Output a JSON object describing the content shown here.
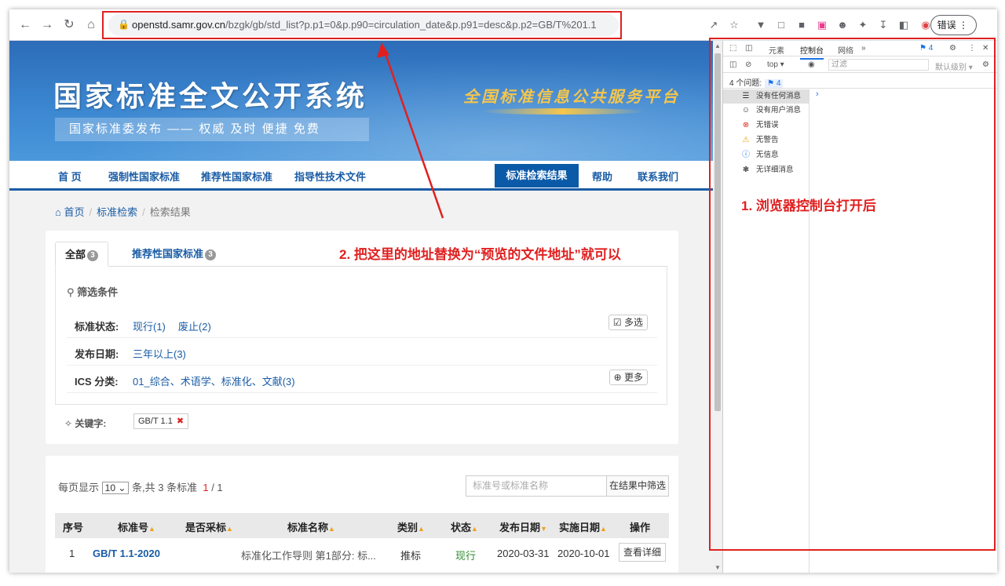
{
  "browser": {
    "url_host": "openstd.samr.gov.cn",
    "url_path": "/bzgk/gb/std_list?p.p1=0&p.p90=circulation_date&p.p91=desc&p.p2=GB/T%201.1",
    "profile_label": "错误"
  },
  "site": {
    "title": "国家标准全文公开系统",
    "subtitle": "国家标准委发布 —— 权威 及时 便捷 免费",
    "slogan": "全国标准信息公共服务平台"
  },
  "nav": {
    "items": [
      "首 页",
      "强制性国家标准",
      "推荐性国家标准",
      "指导性技术文件"
    ],
    "active": "标准检索结果",
    "right_items": [
      "帮助",
      "联系我们"
    ]
  },
  "breadcrumb": {
    "home": "首页",
    "search": "标准检索",
    "current": "检索结果"
  },
  "tabs": [
    {
      "label": "全部",
      "count": "3"
    },
    {
      "label": "推荐性国家标准",
      "count": "3"
    }
  ],
  "filters": {
    "heading": "筛选条件",
    "status_label": "标准状态:",
    "status_values": [
      "现行(1)",
      "废止(2)"
    ],
    "multi_select": "多选",
    "date_label": "发布日期:",
    "date_values": [
      "三年以上(3)"
    ],
    "ics_label": "ICS 分类:",
    "ics_values": [
      "01_综合、术语学、标准化、文献(3)"
    ],
    "more": "更多",
    "keyword_label": "关键字:",
    "keyword_value": "GB/T 1.1"
  },
  "results": {
    "per_page_prefix": "每页显示",
    "per_page_value": "10",
    "per_page_suffix": "条,共 3 条标准",
    "page_current": "1",
    "page_total": "/ 1",
    "search_placeholder": "标准号或标准名称",
    "search_button": "在结果中筛选",
    "columns": [
      "序号",
      "标准号",
      "是否采标",
      "标准名称",
      "类别",
      "状态",
      "发布日期",
      "实施日期",
      "操作"
    ],
    "rows": [
      {
        "index": "1",
        "code": "GB/T 1.1-2020",
        "adopted": "",
        "name": "标准化工作导则 第1部分: 标...",
        "category": "推标",
        "status": "现行",
        "published": "2020-03-31",
        "effective": "2020-10-01",
        "action": "查看详细"
      }
    ]
  },
  "devtools": {
    "tabs": [
      "元素",
      "控制台",
      "网络"
    ],
    "issue_badge": "4",
    "context": "top",
    "filter_placeholder": "过滤",
    "level": "默认级别",
    "issues_text": "4 个问题:",
    "issues_count": "4",
    "sidebar": [
      "没有任何消息",
      "没有用户消息",
      "无错误",
      "无警告",
      "无信息",
      "无详细消息"
    ]
  },
  "annotations": {
    "step1": "1. 浏览器控制台打开后",
    "step2": "2. 把这里的地址替换为“预览的文件地址”就可以"
  },
  "colors": {
    "annotation": "#e02020",
    "brand": "#1a5ca5",
    "nav_active": "#0b5aa8"
  }
}
